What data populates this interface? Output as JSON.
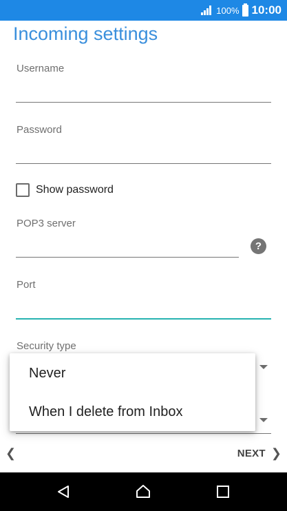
{
  "status_bar": {
    "battery_percent": "100%",
    "time": "10:00",
    "background_color": "#1e88e5"
  },
  "page": {
    "title": "Incoming settings"
  },
  "form": {
    "username_label": "Username",
    "username_value": "",
    "password_label": "Password",
    "password_value": "",
    "show_password_label": "Show password",
    "show_password_checked": false,
    "pop3_server_label": "POP3 server",
    "pop3_server_value": "",
    "port_label": "Port",
    "port_value": "",
    "security_type_label": "Security type",
    "accent_color": "#26b3b1"
  },
  "popup_menu": {
    "options": [
      "Never",
      "When I delete from Inbox"
    ]
  },
  "footer": {
    "next_label": "NEXT"
  },
  "nav_bar": {
    "back_icon": "back-triangle-icon",
    "home_icon": "home-icon",
    "recents_icon": "recents-square-icon"
  }
}
